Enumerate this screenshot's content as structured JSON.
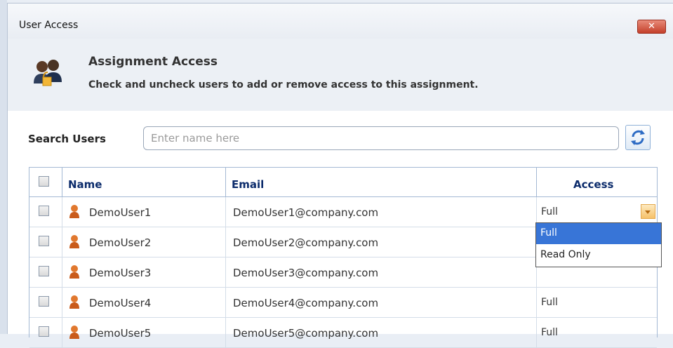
{
  "window": {
    "title": "User Access",
    "close_icon": "close-icon"
  },
  "header": {
    "title": "Assignment Access",
    "description": "Check and uncheck users to add or remove access to this assignment.",
    "icon": "users-lock-icon"
  },
  "search": {
    "label": "Search Users",
    "placeholder": "Enter name here",
    "value": "",
    "refresh_icon": "refresh-icon"
  },
  "table": {
    "columns": [
      "Name",
      "Email",
      "Access"
    ],
    "rows": [
      {
        "name": "DemoUser1",
        "email": "DemoUser1@company.com",
        "access": "Full",
        "checked": false
      },
      {
        "name": "DemoUser2",
        "email": "DemoUser2@company.com",
        "access": "",
        "checked": false
      },
      {
        "name": "DemoUser3",
        "email": "DemoUser3@company.com",
        "access": "",
        "checked": false
      },
      {
        "name": "DemoUser4",
        "email": "DemoUser4@company.com",
        "access": "Full",
        "checked": false
      },
      {
        "name": "DemoUser5",
        "email": "DemoUser5@company.com",
        "access": "Full",
        "checked": false
      }
    ]
  },
  "access_dropdown": {
    "options": [
      "Full",
      "Read Only"
    ],
    "selected": "Full"
  },
  "colors": {
    "header_text": "#0b2b6b",
    "selected_option": "#3875d7",
    "close_button": "#c4402b"
  }
}
